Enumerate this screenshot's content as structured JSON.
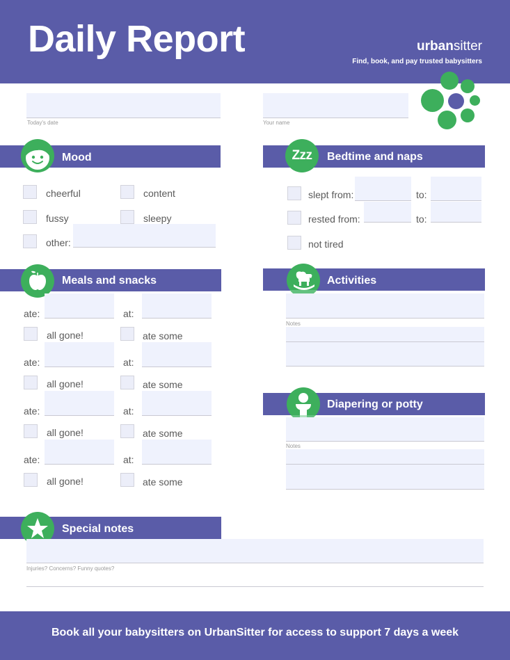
{
  "header": {
    "title": "Daily Report",
    "brand_bold": "urban",
    "brand_light": "sitter",
    "tagline": "Find, book, and pay trusted babysitters"
  },
  "top_fields": {
    "date_caption": "Today's date",
    "date_value": "",
    "name_caption": "Your name",
    "name_value": ""
  },
  "sections": {
    "mood": {
      "title": "Mood",
      "icon": "smiley-face-icon",
      "options": [
        "cheerful",
        "content",
        "fussy",
        "sleepy"
      ],
      "other_label": "other:",
      "other_value": ""
    },
    "bedtime": {
      "title": "Bedtime and naps",
      "icon_text": "Zzz",
      "slept_from_label": "slept from:",
      "rested_from_label": "rested from:",
      "to_label": "to:",
      "not_tired_label": "not tired"
    },
    "meals": {
      "title": "Meals and snacks",
      "icon": "apple-icon",
      "ate_label": "ate:",
      "at_label": "at:",
      "all_gone_label": "all gone!",
      "ate_some_label": "ate some",
      "rows": 4
    },
    "activities": {
      "title": "Activities",
      "icon": "rocking-horse-icon",
      "notes_caption": "Notes"
    },
    "diapering": {
      "title": "Diapering or potty",
      "icon": "toilet-icon",
      "notes_caption": "Notes"
    },
    "special": {
      "title": "Special notes",
      "icon": "star-icon",
      "caption": "Injuries? Concerns? Funny quotes?"
    }
  },
  "footer": {
    "text": "Book all your babysitters on UrbanSitter for access to support 7 days a week"
  },
  "colors": {
    "brand_purple": "#5a5ca8",
    "brand_green": "#3daf5c",
    "field_fill": "#eff2fd"
  }
}
